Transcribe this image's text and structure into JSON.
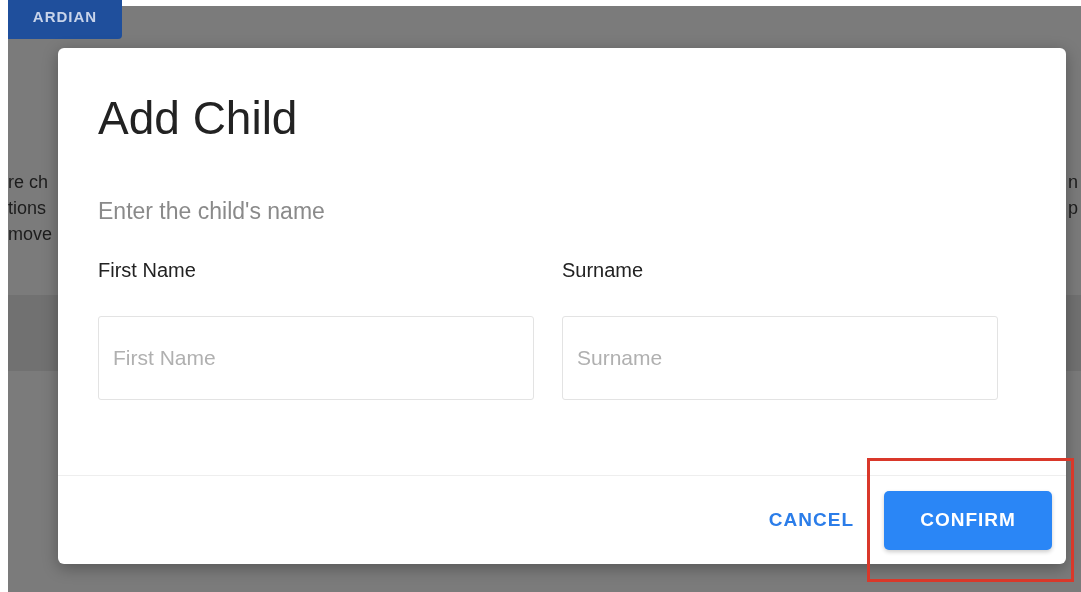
{
  "background": {
    "top_button": "ARDIAN",
    "left_text": [
      "re ch",
      "tions",
      "move"
    ],
    "right_text": [
      "n",
      "p"
    ]
  },
  "dialog": {
    "title": "Add Child",
    "subtitle": "Enter the child's name",
    "fields": [
      {
        "label": "First Name",
        "placeholder": "First Name"
      },
      {
        "label": "Surname",
        "placeholder": "Surname"
      }
    ],
    "buttons": [
      {
        "label": "CANCEL",
        "kind": "text"
      },
      {
        "label": "CONFIRM",
        "kind": "contained",
        "highlighted": true
      }
    ]
  }
}
